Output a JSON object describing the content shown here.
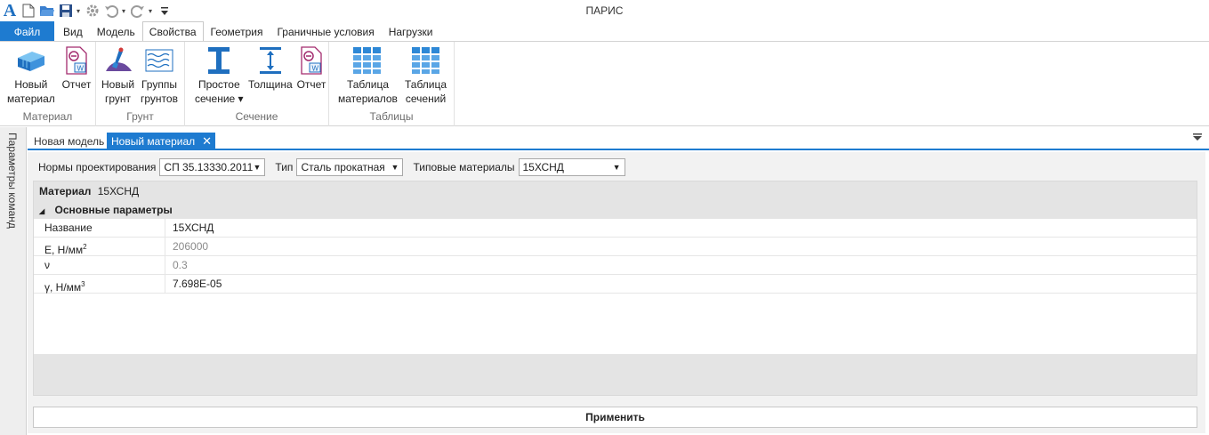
{
  "app": {
    "title": "ПАРИС"
  },
  "qat": {
    "logo": "A",
    "icons": [
      "new-file-icon",
      "open-folder-icon",
      "save-icon",
      "settings-icon",
      "undo-icon",
      "redo-icon",
      "customize-icon"
    ]
  },
  "tabs": {
    "file": "Файл",
    "items": [
      "Вид",
      "Модель",
      "Свойства",
      "Геометрия",
      "Граничные условия",
      "Нагрузки"
    ],
    "active": "Свойства"
  },
  "ribbon": {
    "groups": [
      {
        "title": "Материал",
        "buttons": [
          {
            "line1": "Новый",
            "line2": "материал"
          },
          {
            "line1": "Отчет",
            "line2": ""
          }
        ]
      },
      {
        "title": "Грунт",
        "buttons": [
          {
            "line1": "Новый",
            "line2": "грунт"
          },
          {
            "line1": "Группы",
            "line2": "грунтов"
          }
        ]
      },
      {
        "title": "Сечение",
        "buttons": [
          {
            "line1": "Простое",
            "line2": "сечение ▾"
          },
          {
            "line1": "Толщина",
            "line2": ""
          },
          {
            "line1": "Отчет",
            "line2": ""
          }
        ]
      },
      {
        "title": "Таблицы",
        "buttons": [
          {
            "line1": "Таблица",
            "line2": "материалов"
          },
          {
            "line1": "Таблица",
            "line2": "сечений"
          }
        ]
      }
    ]
  },
  "sidepanel": {
    "label": "Параметры команд"
  },
  "doctabs": {
    "items": [
      "Новая модель",
      "Новый материал"
    ],
    "active": "Новый материал",
    "close": "✕"
  },
  "filters": {
    "norms_label": "Нормы проектирования",
    "norms_value": "СП 35.13330.2011",
    "type_label": "Тип",
    "type_value": "Сталь прокатная",
    "materials_label": "Типовые материалы",
    "materials_value": "15ХСНД"
  },
  "grid": {
    "header_label": "Материал",
    "header_value": "15ХСНД",
    "category": "Основные параметры",
    "rows": [
      {
        "key": "Название",
        "unit_sup": "",
        "value": "15ХСНД",
        "muted": false
      },
      {
        "key": "E, Н/мм",
        "unit_sup": "2",
        "value": "206000",
        "muted": true
      },
      {
        "key": "ν",
        "unit_sup": "",
        "value": "0.3",
        "muted": true
      },
      {
        "key": "γ, Н/мм",
        "unit_sup": "3",
        "value": "7.698E-05",
        "muted": false
      }
    ]
  },
  "apply": {
    "label": "Применить"
  },
  "colors": {
    "accent": "#1e7bd0"
  }
}
